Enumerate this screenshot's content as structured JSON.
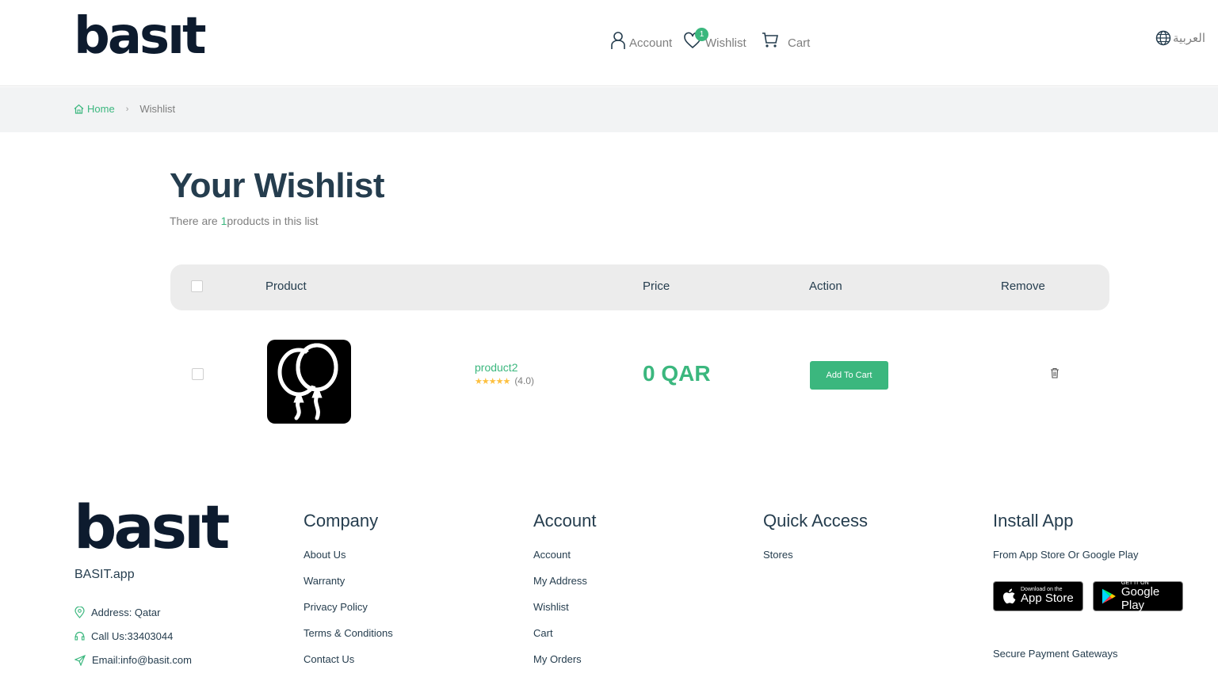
{
  "header": {
    "logo": "basıt",
    "nav": {
      "account": "Account",
      "wishlist": "Wishlist",
      "wishlist_count": "1",
      "cart": "Cart"
    },
    "language": "العربية"
  },
  "breadcrumb": {
    "home": "Home",
    "current": "Wishlist"
  },
  "page": {
    "title": "Your Wishlist",
    "subtitle_prefix": "There are ",
    "count": "1",
    "subtitle_suffix": "products in this list"
  },
  "table": {
    "headers": {
      "product": "Product",
      "price": "Price",
      "action": "Action",
      "remove": "Remove"
    },
    "rows": [
      {
        "name": "product2",
        "rating_stars": "★★★★★",
        "rating": "(4.0)",
        "price": "0 QAR",
        "action": "Add To Cart"
      }
    ]
  },
  "footer": {
    "logo": "basıt",
    "app_name": "BASIT.app",
    "address": "Address: Qatar",
    "phone": "Call Us:33403044",
    "email": "Email:info@basit.com",
    "company": {
      "title": "Company",
      "links": [
        "About Us",
        "Warranty",
        "Privacy Policy",
        "Terms & Conditions",
        "Contact Us"
      ]
    },
    "account": {
      "title": "Account",
      "links": [
        "Account",
        "My Address",
        "Wishlist",
        "Cart",
        "My Orders"
      ]
    },
    "quick_access": {
      "title": "Quick Access",
      "links": [
        "Stores"
      ]
    },
    "install": {
      "title": "Install App",
      "text": "From App Store Or Google Play",
      "app_store_small": "Download on the",
      "app_store_big": "App Store",
      "google_play_small": "GET IT ON",
      "google_play_big": "Google Play",
      "secure": "Secure Payment Gateways"
    }
  },
  "colors": {
    "accent": "#3bb77e",
    "heading": "#253d4e",
    "muted": "#7e7e7e"
  }
}
